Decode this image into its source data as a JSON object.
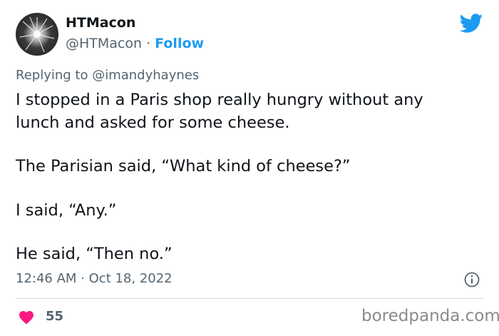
{
  "author": {
    "name": "HTMacon",
    "handle": "@HTMacon",
    "separator": " · ",
    "follow_label": "Follow"
  },
  "reply": {
    "prefix": "Replying to ",
    "mention": "@imandyhaynes"
  },
  "tweet": {
    "line1": "I stopped in a Paris shop really hungry without any",
    "line2": "lunch and asked for some cheese.",
    "line3": " The Parisian said, “What kind of cheese?”",
    "line4": "I said, “Any.”",
    "line5": "He said, “Then no.”"
  },
  "meta": {
    "time": "12:46 AM",
    "separator": " · ",
    "date": "Oct 18, 2022"
  },
  "engagement": {
    "likes": "55"
  },
  "watermark": "boredpanda.com",
  "icons": {
    "brand": "twitter-bird-icon",
    "info": "info-icon",
    "like": "heart-icon"
  },
  "colors": {
    "accent": "#1d9bf0",
    "like": "#f91880",
    "secondary_text": "#536471"
  }
}
